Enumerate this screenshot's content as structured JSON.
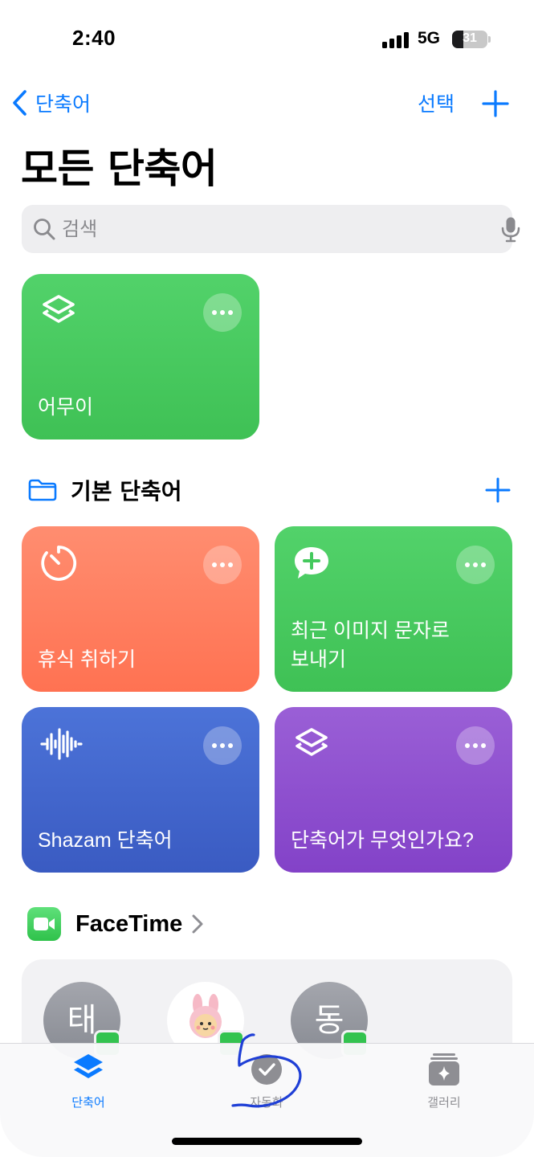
{
  "status_bar": {
    "time": "2:40",
    "network": "5G",
    "battery": "31",
    "battery_level": 0.31
  },
  "nav": {
    "back_label": "단축어",
    "select_label": "선택"
  },
  "page_title": "모든 단축어",
  "search": {
    "placeholder": "검색"
  },
  "top_shortcut": {
    "label": "어무이",
    "icon": "shortcuts-layers-icon",
    "color": "#4cd964"
  },
  "folder": {
    "label": "기본 단축어"
  },
  "shortcuts": [
    {
      "label": "휴식 취하기",
      "icon": "timer-icon",
      "color": "#ff7e5f"
    },
    {
      "label": "최근 이미지 문자로\n보내기",
      "icon": "message-plus-icon",
      "color": "#4cd964"
    },
    {
      "label": "Shazam 단축어",
      "icon": "waveform-icon",
      "color": "#4467cf"
    },
    {
      "label": "단축어가 무엇인가요?",
      "icon": "shortcuts-layers-icon",
      "color": "#8e4fcf"
    }
  ],
  "facetime": {
    "title": "FaceTime",
    "contacts": [
      {
        "initial": "태"
      },
      {
        "initial": ""
      },
      {
        "initial": "동"
      }
    ]
  },
  "tabs": [
    {
      "label": "단축어",
      "icon": "shortcuts-layers-icon",
      "active": true
    },
    {
      "label": "자동화",
      "icon": "checkmark-clock-icon",
      "active": false
    },
    {
      "label": "갤러리",
      "icon": "sparkle-gallery-icon",
      "active": false
    }
  ],
  "annotation": {
    "text": "5",
    "color": "#1f3fd6"
  }
}
